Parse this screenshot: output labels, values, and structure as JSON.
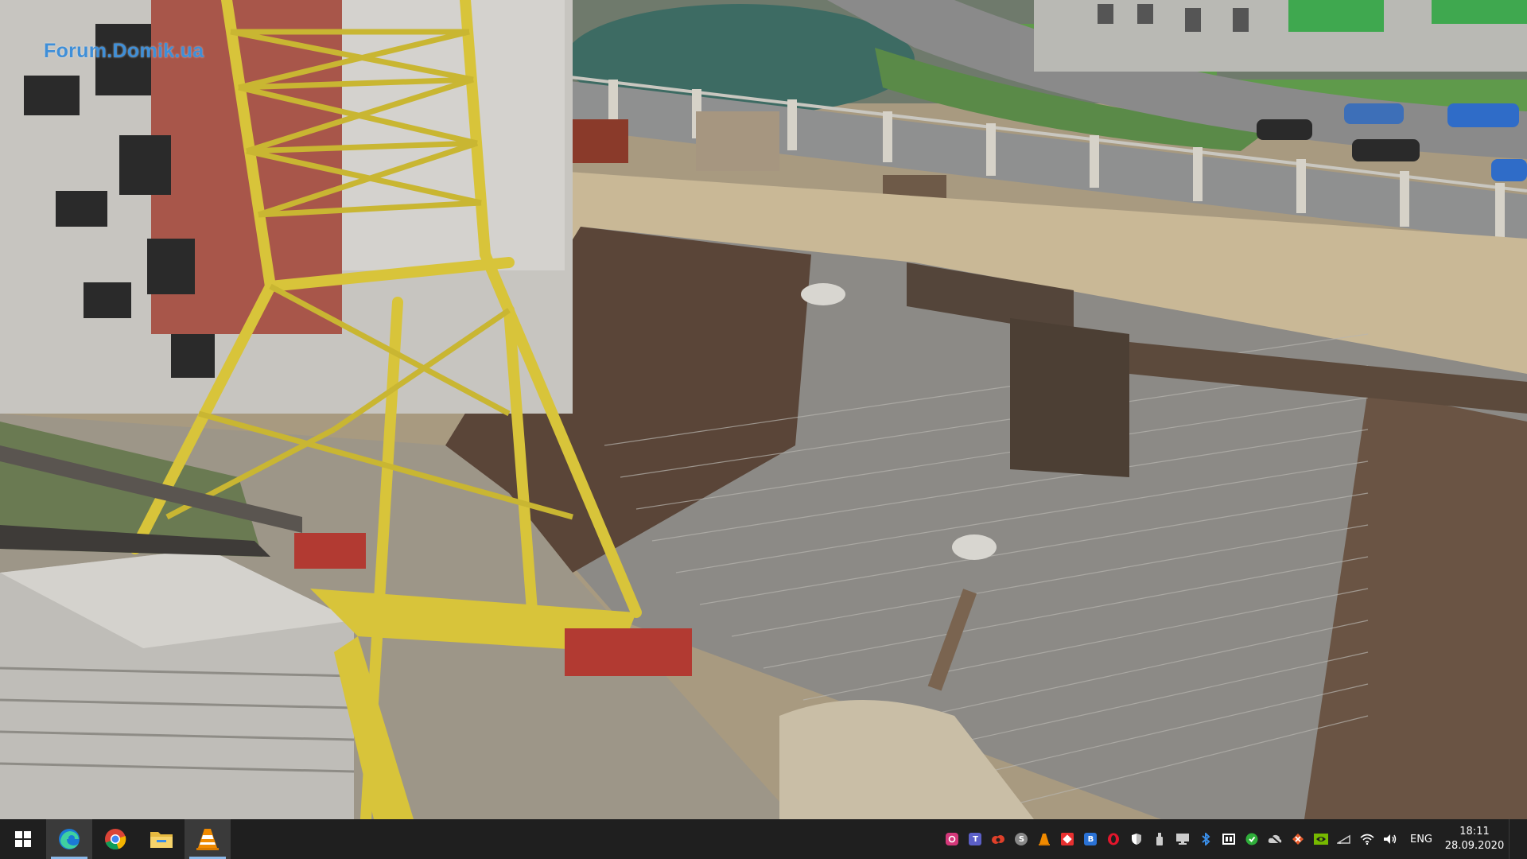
{
  "desktop": {
    "wallpaper": "construction-site-aerial-photo",
    "watermark": "Forum.Domik.ua"
  },
  "taskbar": {
    "start": "windows-start-icon",
    "pinned_apps": [
      {
        "name": "edge",
        "icon": "edge-icon",
        "color": "#2aa0e0",
        "active": true
      },
      {
        "name": "chrome",
        "icon": "chrome-icon",
        "color": "#e8b400",
        "active": false
      },
      {
        "name": "file-explorer",
        "icon": "folder-icon",
        "color": "#f2c94c",
        "active": false
      },
      {
        "name": "vlc",
        "icon": "vlc-cone-icon",
        "color": "#f08a00",
        "active": true
      }
    ],
    "tray_icons": [
      {
        "icon": "instagram-icon",
        "color": "#d4387a",
        "glyph": ""
      },
      {
        "icon": "teams-icon",
        "color": "#5b5fc7",
        "glyph": "T"
      },
      {
        "icon": "cloud-sync-icon",
        "color": "#e0402a",
        "glyph": ""
      },
      {
        "icon": "skype-icon",
        "color": "#888888",
        "glyph": "S"
      },
      {
        "icon": "vlc-tray-icon",
        "color": "#f08a00",
        "glyph": ""
      },
      {
        "icon": "anydesk-icon",
        "color": "#e83030",
        "glyph": ""
      },
      {
        "icon": "bitwarden-icon",
        "color": "#2a72d6",
        "glyph": "B"
      },
      {
        "icon": "opera-icon",
        "color": "#e3162c",
        "glyph": ""
      },
      {
        "icon": "security-shield-icon",
        "color": "#ffffff",
        "glyph": ""
      },
      {
        "icon": "usb-drive-icon",
        "color": "#cccccc",
        "glyph": ""
      },
      {
        "icon": "monitor-icon",
        "color": "#cccccc",
        "glyph": ""
      },
      {
        "icon": "bluetooth-icon",
        "color": "#3a8ee8",
        "glyph": ""
      },
      {
        "icon": "display-switch-icon",
        "color": "#ffffff",
        "glyph": ""
      },
      {
        "icon": "green-sync-icon",
        "color": "#2fae3a",
        "glyph": ""
      },
      {
        "icon": "cloud-offline-icon",
        "color": "#cccccc",
        "glyph": ""
      },
      {
        "icon": "network-x-icon",
        "color": "#e85a2a",
        "glyph": ""
      },
      {
        "icon": "nvidia-icon",
        "color": "#76b900",
        "glyph": ""
      },
      {
        "icon": "battery-icon",
        "color": "#cccccc",
        "glyph": ""
      },
      {
        "icon": "wifi-icon",
        "color": "#ffffff",
        "glyph": ""
      },
      {
        "icon": "volume-icon",
        "color": "#ffffff",
        "glyph": ""
      }
    ],
    "language": "ENG",
    "time": "18:11",
    "date": "28.09.2020"
  }
}
